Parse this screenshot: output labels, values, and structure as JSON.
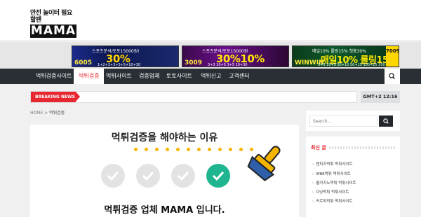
{
  "header": {
    "logo_tagline": "안전 놀이터 필요할땐",
    "logo_name": "MAMA"
  },
  "banners": [
    {
      "top": "스포츠분석/토토15000원!",
      "big": "30%",
      "num": "6005",
      "bottom": "1+2+3+3+3+5+10+30"
    },
    {
      "top": "스포츠분석/토토15000원",
      "big": "30%10%",
      "num": "3009",
      "bottom": "3+3 10+5 3+5 10+30"
    },
    {
      "top": "매일10% 롤링15% 첫충30%",
      "big": "매일10% 롤링15%",
      "num": "WINWIN",
      "bottom": "3+3 10+5 30+10 50+15 100+25 200+50",
      "side": "7009"
    }
  ],
  "nav": {
    "items": [
      "먹튀검증사이트",
      "먹튀검증",
      "먹튀사이트",
      "검증업체",
      "토토사이트",
      "먹튀신고",
      "고객센터"
    ],
    "active_index": 1
  },
  "breaking": {
    "label": "BREAKING NEWS",
    "time": "GMT+2 12:16"
  },
  "breadcrumb": {
    "home": "HOME",
    "sep": ">",
    "current": "먹튀검증"
  },
  "card": {
    "title": "먹튀검증을 해야하는 이유",
    "subtitle": "먹튀검증 업체 MAMA 입니다."
  },
  "sidebar": {
    "search_placeholder": "Search...",
    "recent_title": "최신 글",
    "recent_items": [
      "엔피즈먹튀 먹튀사이트",
      "W88먹튀 먹튀사이트",
      "콜카지노먹튀 먹튀사이트",
      "다낭먹튀 먹튀사이트",
      "카르피먹튀 먹튀사이트"
    ]
  },
  "colors": {
    "accent": "#e8262f",
    "nav_bg": "#2a2f35",
    "check_on": "#1fb591",
    "dot": "#f5b400"
  },
  "icons": [
    "search-icon",
    "check-icon",
    "stamp-icon"
  ]
}
